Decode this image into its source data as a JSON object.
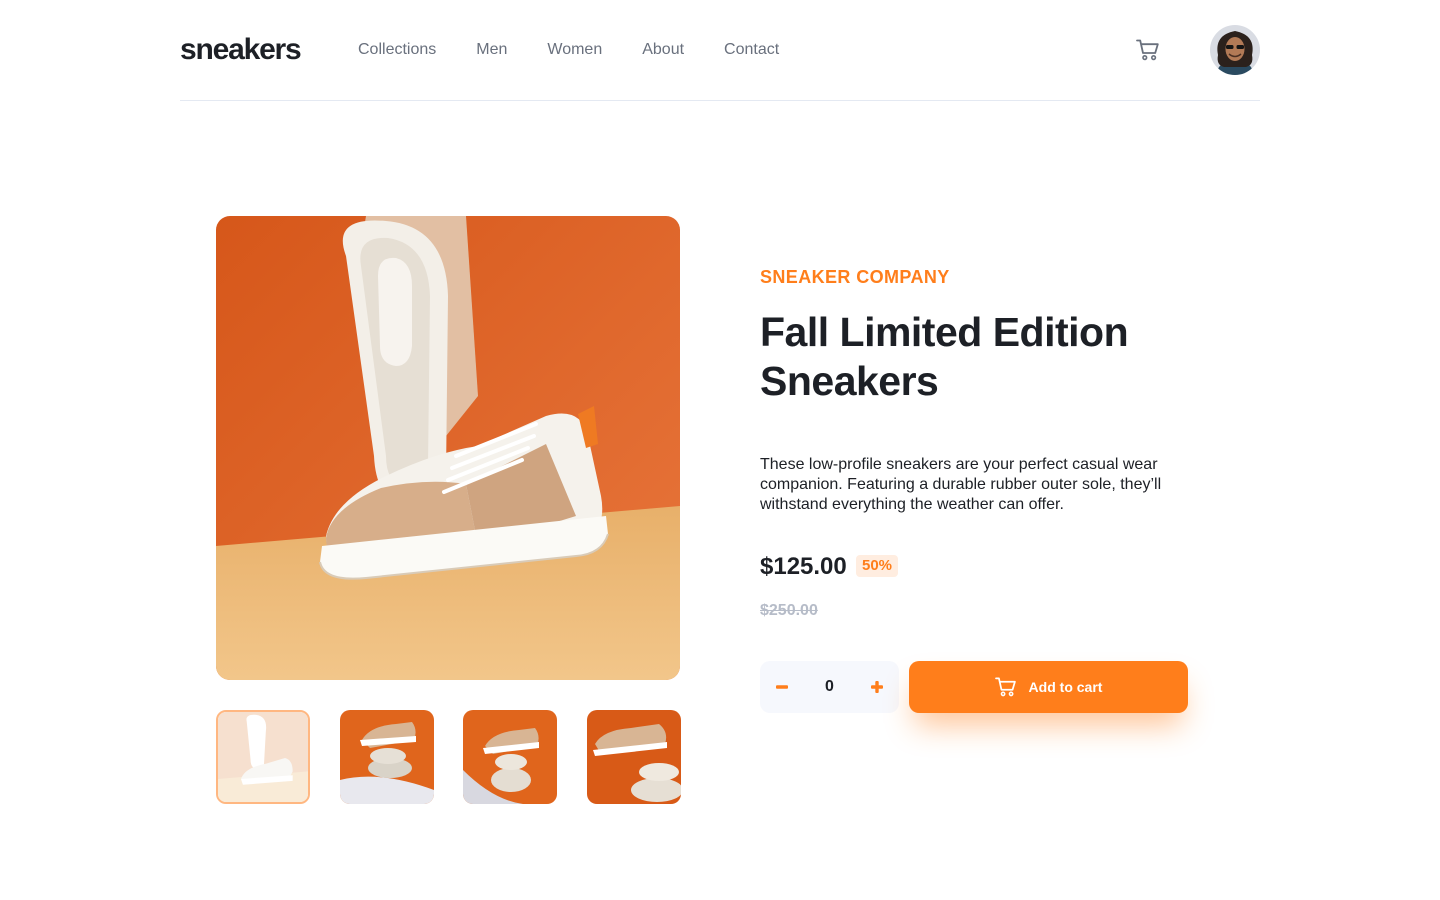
{
  "header": {
    "logo": "sneakers",
    "nav": [
      "Collections",
      "Men",
      "Women",
      "About",
      "Contact"
    ]
  },
  "product": {
    "company": "SNEAKER COMPANY",
    "title": "Fall Limited Edition Sneakers",
    "description": "These low-profile sneakers are your perfect casual wear companion. Featuring a durable rubber outer sole, they’ll withstand everything the weather can offer.",
    "price": "$125.00",
    "discount": "50%",
    "original_price": "$250.00",
    "quantity": "0",
    "minus_symbol": "−",
    "plus_symbol": "+",
    "add_to_cart": "Add to cart"
  },
  "gallery": {
    "selected_thumbnail": 1,
    "thumbnail_count": 4
  },
  "icons": {
    "cart": "cart-icon",
    "avatar": "avatar",
    "add_cart": "cart-icon"
  },
  "colors": {
    "accent": "#ff7e1b",
    "accent_pale": "#ffede0",
    "text_dark": "#1d2026",
    "text_gray": "#69707d",
    "text_light": "#b6bcc8",
    "stepper_bg": "#f6f8fd"
  }
}
